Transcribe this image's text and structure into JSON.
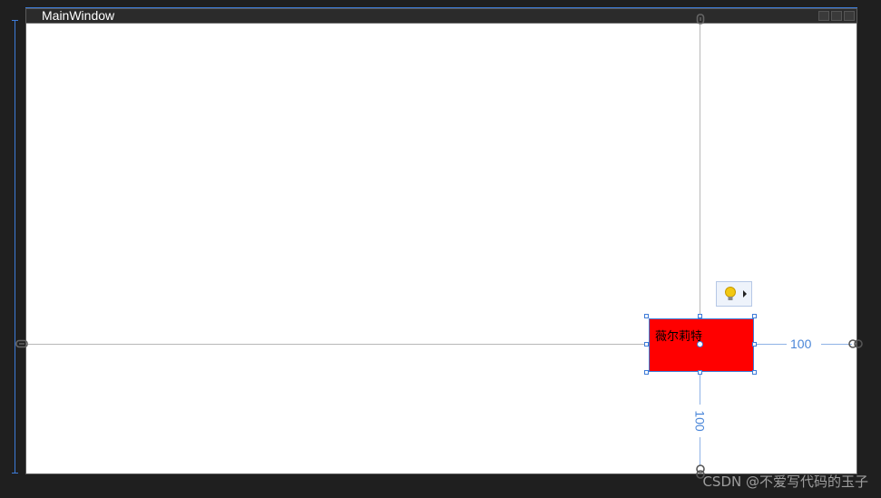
{
  "window": {
    "title": "MainWindow"
  },
  "element": {
    "text": "薇尔莉特",
    "background_color": "#ff0000"
  },
  "margins": {
    "right": "100",
    "bottom": "100"
  },
  "quick_actions": {
    "icon": "lightbulb-icon"
  },
  "watermark": {
    "text": "CSDN @不爱写代码的玉子"
  },
  "colors": {
    "selection": "#3d7bd8",
    "margin_label": "#4a86d8",
    "canvas": "#ffffff",
    "backdrop": "#1f1f1f"
  }
}
